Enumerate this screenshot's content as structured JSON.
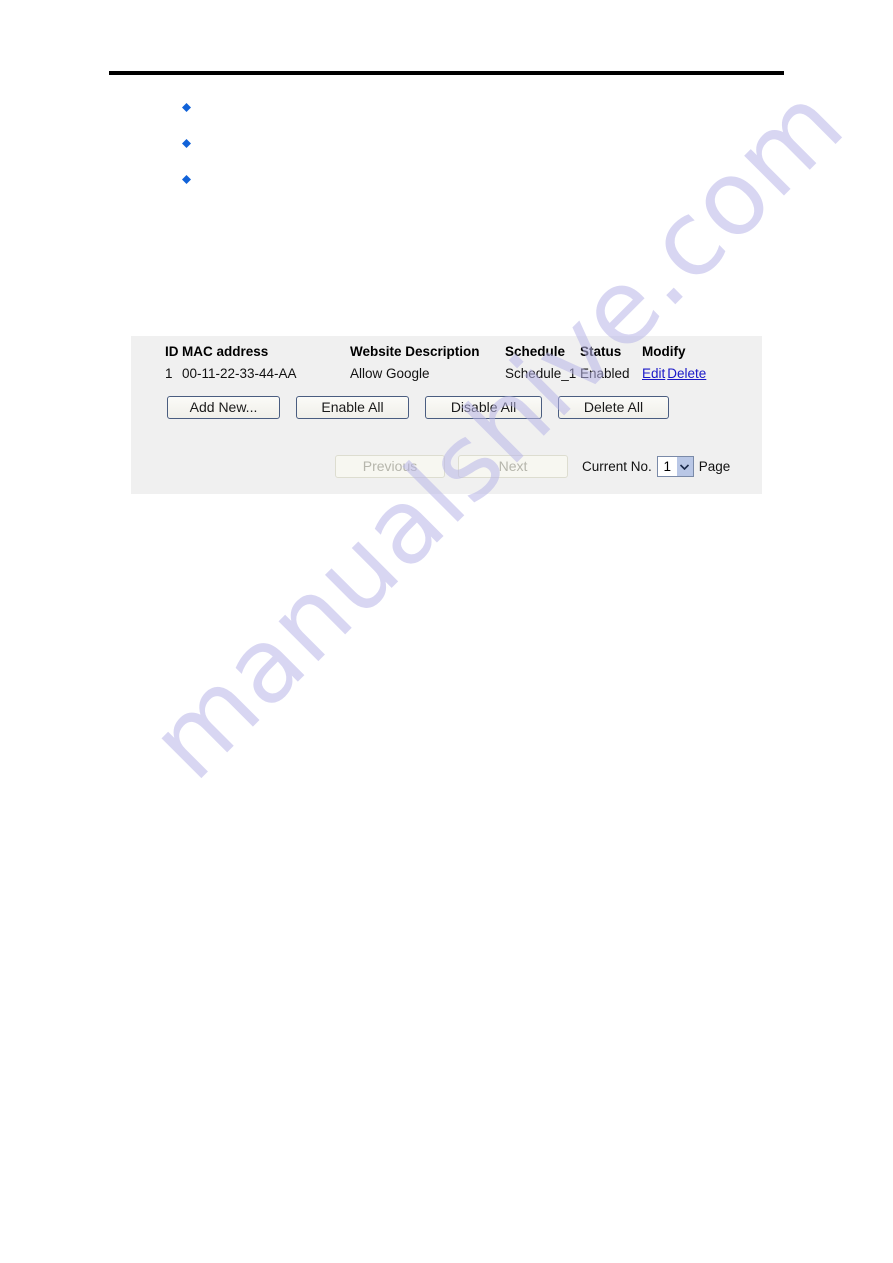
{
  "page": {
    "watermark": "manualshive.com",
    "accent_link_color": "#1a18c8",
    "bullet_color": "#1162d8",
    "panel_bg": "#f0f0f0"
  },
  "bullets": [
    {
      "marker": "diamond-bullet",
      "text": ""
    },
    {
      "marker": "diamond-bullet",
      "text": ""
    },
    {
      "marker": "diamond-bullet",
      "text": ""
    }
  ],
  "rule_table": {
    "headers": {
      "id": "ID",
      "mac": "MAC address",
      "description": "Website Description",
      "schedule": "Schedule",
      "status": "Status",
      "modify": "Modify"
    },
    "rows": [
      {
        "id": "1",
        "mac": "00-11-22-33-44-AA",
        "description": "Allow Google",
        "schedule": "Schedule_1",
        "status": "Enabled",
        "edit_label": "Edit",
        "delete_label": "Delete"
      }
    ]
  },
  "actions": {
    "add_new": "Add New...",
    "enable_all": "Enable All",
    "disable_all": "Disable All",
    "delete_all": "Delete All"
  },
  "pagination": {
    "previous": "Previous",
    "next": "Next",
    "current_label": "Current No.",
    "current_value": "1",
    "page_suffix": "Page",
    "options": [
      "1"
    ]
  }
}
